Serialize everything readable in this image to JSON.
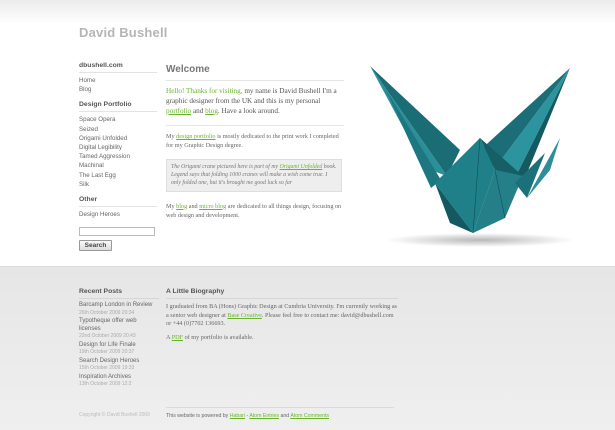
{
  "site": {
    "title": "David Bushell"
  },
  "sidebar": {
    "home_heading": "dbushell.com",
    "home_items": [
      "Home",
      "Blog"
    ],
    "portfolio_heading": "Design Portfolio",
    "portfolio_items": [
      "Space Opera",
      "Seized",
      "Origami Unfolded",
      "Digital Legibility",
      "Tamed Aggression",
      "Machinal",
      "The Last Egg",
      "Silk"
    ],
    "other_heading": "Other",
    "other_items": [
      "Design Heroes"
    ],
    "search_value": "",
    "search_button": "Search"
  },
  "main": {
    "heading": "Welcome",
    "intro": {
      "hello": "Hello! Thanks for visiting,",
      "t1": " my name is David Bushell I'm a graphic designer from the UK and this is my personal ",
      "portfolio": "portfolio",
      "and": " and ",
      "blog": "blog",
      "t2": ". Have a look around."
    },
    "p1": {
      "a": "My ",
      "link": "design portfolio",
      "b": " is mostly dedicated to the print work I completed for my Graphic Design degree."
    },
    "note": {
      "a": "The Origami crane pictured here is part of my ",
      "link": "Origami Unfolded",
      "b": " book. Legend says that folding 1000 cranes will make a wish come true. I only folded one, but it's brought me good luck so far"
    },
    "p2": {
      "a": "My ",
      "link1": "blog",
      "and": " and ",
      "link2": "micro blog",
      "b": " are dedicated to all things design, focusing on web design and development."
    }
  },
  "recent": {
    "heading": "Recent Posts",
    "posts": [
      {
        "title": "Barcamp London in Review",
        "date": "26th October 2009 20:34"
      },
      {
        "title": "Typotheque offer web licenses",
        "date": "22nd October 2009 20:43"
      },
      {
        "title": "Design for Life Finale",
        "date": "19th October 2009 20:37"
      },
      {
        "title": "Search Design Heroes",
        "date": "15th October 2009 19:33"
      },
      {
        "title": "Inspiration Archives",
        "date": "13th October 2009 12:2"
      }
    ]
  },
  "bio": {
    "heading": "A Little Biography",
    "t1": "I graduated from BA (Hons) Graphic Design at Cumbria University. I'm currently working as a senior web designer at ",
    "link": "Base Creative",
    "t2": ". Please feel free to contact me: david@dbushell.com or +44 (0)7702 136693.",
    "pdf_a": "A ",
    "pdf_link": "PDF",
    "pdf_b": " of my portfolio is available."
  },
  "footer": {
    "copyright": "Copyright © David Bushell 2009",
    "powered_a": "This website is powered by ",
    "habari": "Habari",
    "sep1": " - ",
    "atom_entries": "Atom Entries",
    "and": " and ",
    "atom_comments": "Atom Comments"
  },
  "colors": {
    "accent": "#6ab42d",
    "crane": "#1f7d86"
  },
  "icons": [
    "origami-crane-illustration"
  ]
}
